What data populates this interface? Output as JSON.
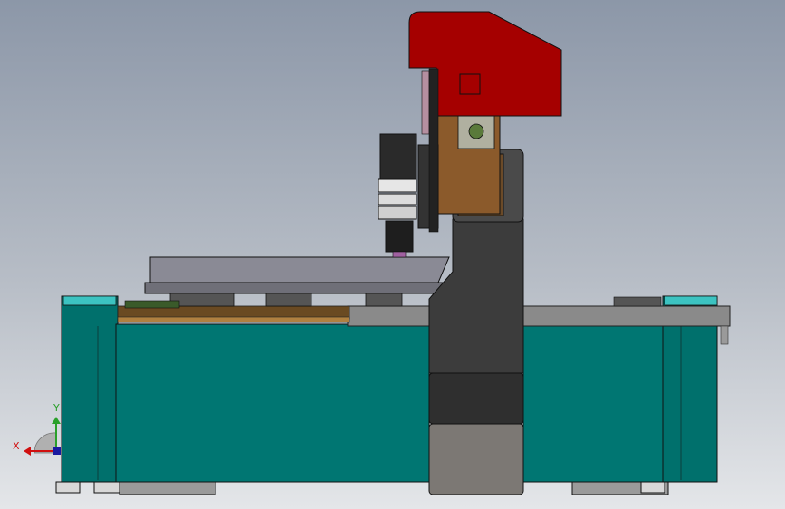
{
  "viewport": {
    "name": "cad-3d-viewport"
  },
  "triad": {
    "x_label": "X",
    "y_label": "Y"
  },
  "colors": {
    "bed": "#007672",
    "bed_highlight": "#2fb7b5",
    "head": "#a50000",
    "column": "#3c3c3c",
    "table": "#8a8a92",
    "frame": "#808080"
  },
  "model_parts": [
    "machine-bed",
    "gantry-column",
    "spindle-head",
    "spindle-motor",
    "worktable",
    "x-axis-rail",
    "z-axis-carriage",
    "leveling-feet"
  ]
}
